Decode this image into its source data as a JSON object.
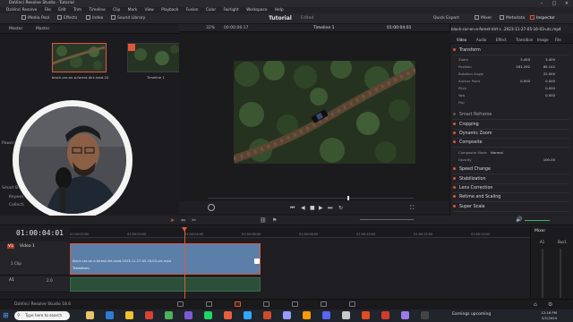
{
  "titlebar": {
    "title": "DaVinci Resolve Studio - Tutorial"
  },
  "menu": [
    "DaVinci Resolve",
    "File",
    "Edit",
    "Trim",
    "Timeline",
    "Clip",
    "Mark",
    "View",
    "Playback",
    "Fusion",
    "Color",
    "Fairlight",
    "Workspace",
    "Help"
  ],
  "toolbar": {
    "media_pool": "Media Pool",
    "effects": "Effects",
    "index": "Index",
    "sound_library": "Sound Library",
    "project_title": "Tutorial",
    "project_status": "Edited",
    "quick_export": "Quick Export",
    "mixer": "Mixer",
    "metadata": "Metadata",
    "inspector": "Inspector"
  },
  "media_pool": {
    "tab_master": "Master",
    "tab_master2": "Master",
    "clips": [
      {
        "label": "black-car-on-a-forest-dirt-road-20..."
      },
      {
        "label": "Timeline 1"
      }
    ],
    "side_power": "Power",
    "side_smart": "Smart B",
    "side_keywords": "Keywor",
    "side_collections": "Collecti"
  },
  "viewer": {
    "zoom": "32%",
    "source_timecode": "00:00:06:17",
    "timeline_name": "Timeline 1",
    "record_timecode": "01:00:04:01",
    "clip_name": "black-car-on-a-forest-dirt-r...2023-11-27-05-16-03-utc.mp4"
  },
  "inspector": {
    "tabs": [
      "Video",
      "Audio",
      "Effect",
      "Transition",
      "Image",
      "File"
    ],
    "sections": {
      "transform": "Transform",
      "smart_reframe": "Smart Reframe",
      "cropping": "Cropping",
      "dynamic_zoom": "Dynamic Zoom",
      "composite": "Composite",
      "speed_change": "Speed Change",
      "stabilization": "Stabilization",
      "lens_correction": "Lens Correction",
      "retime_scaling": "Retime and Scaling",
      "super_scale": "Super Scale"
    },
    "params": {
      "zoom_label": "Zoom",
      "zoom_x": "3.400",
      "zoom_y": "3.400",
      "position_label": "Position",
      "position_x": "161.292",
      "position_y": "85.142",
      "rotation_label": "Rotation Angle",
      "rotation": "22.500",
      "anchor_label": "Anchor Point",
      "anchor_x": "0.000",
      "anchor_y": "0.000",
      "pitch_label": "Pitch",
      "pitch": "0.000",
      "yaw_label": "Yaw",
      "yaw": "0.000",
      "flip_label": "Flip",
      "composite_mode_label": "Composite Mode",
      "composite_mode": "Normal",
      "opacity_label": "Opacity",
      "opacity": "100.00"
    }
  },
  "timeline": {
    "timecode": "01:00:04:01",
    "ruler": [
      "01:00:00:00",
      "01:00:02:00",
      "01:00:04:00",
      "01:00:06:00",
      "01:00:08:00",
      "01:00:10:00",
      "01:00:12:00",
      "01:00:14:00"
    ],
    "v1": "V1",
    "v1_name": "Video 1",
    "v1_clips": "1 Clip",
    "a1": "A1",
    "a1_level": "2.0",
    "video_clip_name": "black-car-on-a-forest-dirt-road-2023-11-27-05-16-03-utc.mp4",
    "video_clip_effect": "Transform",
    "mixer_title": "Mixer",
    "mixer_a1": "A1",
    "mixer_bus": "Bus1"
  },
  "app_footer": {
    "name": "DaVinci Resolve Studio 18.6"
  },
  "taskbar": {
    "search_placeholder": "Type here to search",
    "news": "Earnings upcoming",
    "time": "12:16 PM",
    "date": "5/1/2024"
  },
  "colors": {
    "accent": "#e0573a",
    "video_clip": "#5b7fa8",
    "audio_clip": "#2b4f39"
  }
}
